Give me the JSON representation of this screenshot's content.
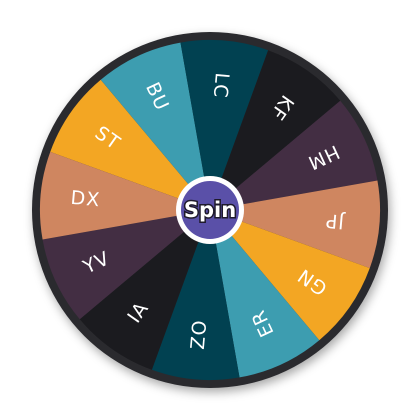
{
  "wheel": {
    "segments": [
      {
        "label": "ST",
        "color": "#f3a623"
      },
      {
        "label": "BU",
        "color": "#3d9db0"
      },
      {
        "label": "LC",
        "color": "#014151"
      },
      {
        "label": "KF",
        "color": "#1b1b1f"
      },
      {
        "label": "HM",
        "color": "#432e43"
      },
      {
        "label": "JP",
        "color": "#cf8660"
      },
      {
        "label": "GN",
        "color": "#f3a623"
      },
      {
        "label": "ER",
        "color": "#3d9db0"
      },
      {
        "label": "ZO",
        "color": "#014151"
      },
      {
        "label": "IA",
        "color": "#1b1b1f"
      },
      {
        "label": "YV",
        "color": "#432e43"
      },
      {
        "label": "DX",
        "color": "#cf8660"
      }
    ],
    "rim_color": "#2a2a2e",
    "spin_button": {
      "label": "Spin",
      "fill": "#5a50a8",
      "ring": "#ffffff"
    }
  }
}
